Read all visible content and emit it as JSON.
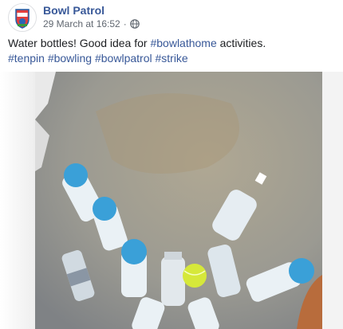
{
  "post": {
    "author": "Bowl Patrol",
    "timestamp": "29 March at 16:52",
    "separator": "·",
    "privacy_icon": "globe-icon",
    "text_before": "Water bottles! Good idea for ",
    "hashtag_inline": "#bowlathome",
    "text_after": " activities.",
    "hashtags": [
      "#tenpin",
      "#bowling",
      "#bowlpatrol",
      "#strike"
    ]
  },
  "avatar": {
    "icon": "bowl-patrol-logo-icon"
  },
  "media": {
    "icon": "video-frame",
    "subject": "water-bottles-as-bowling-pins"
  },
  "colors": {
    "link": "#385898",
    "text": "#1c1e21",
    "meta": "#606770",
    "bottle_cap": "#3aa0d8",
    "ball": "#d6e83a"
  }
}
